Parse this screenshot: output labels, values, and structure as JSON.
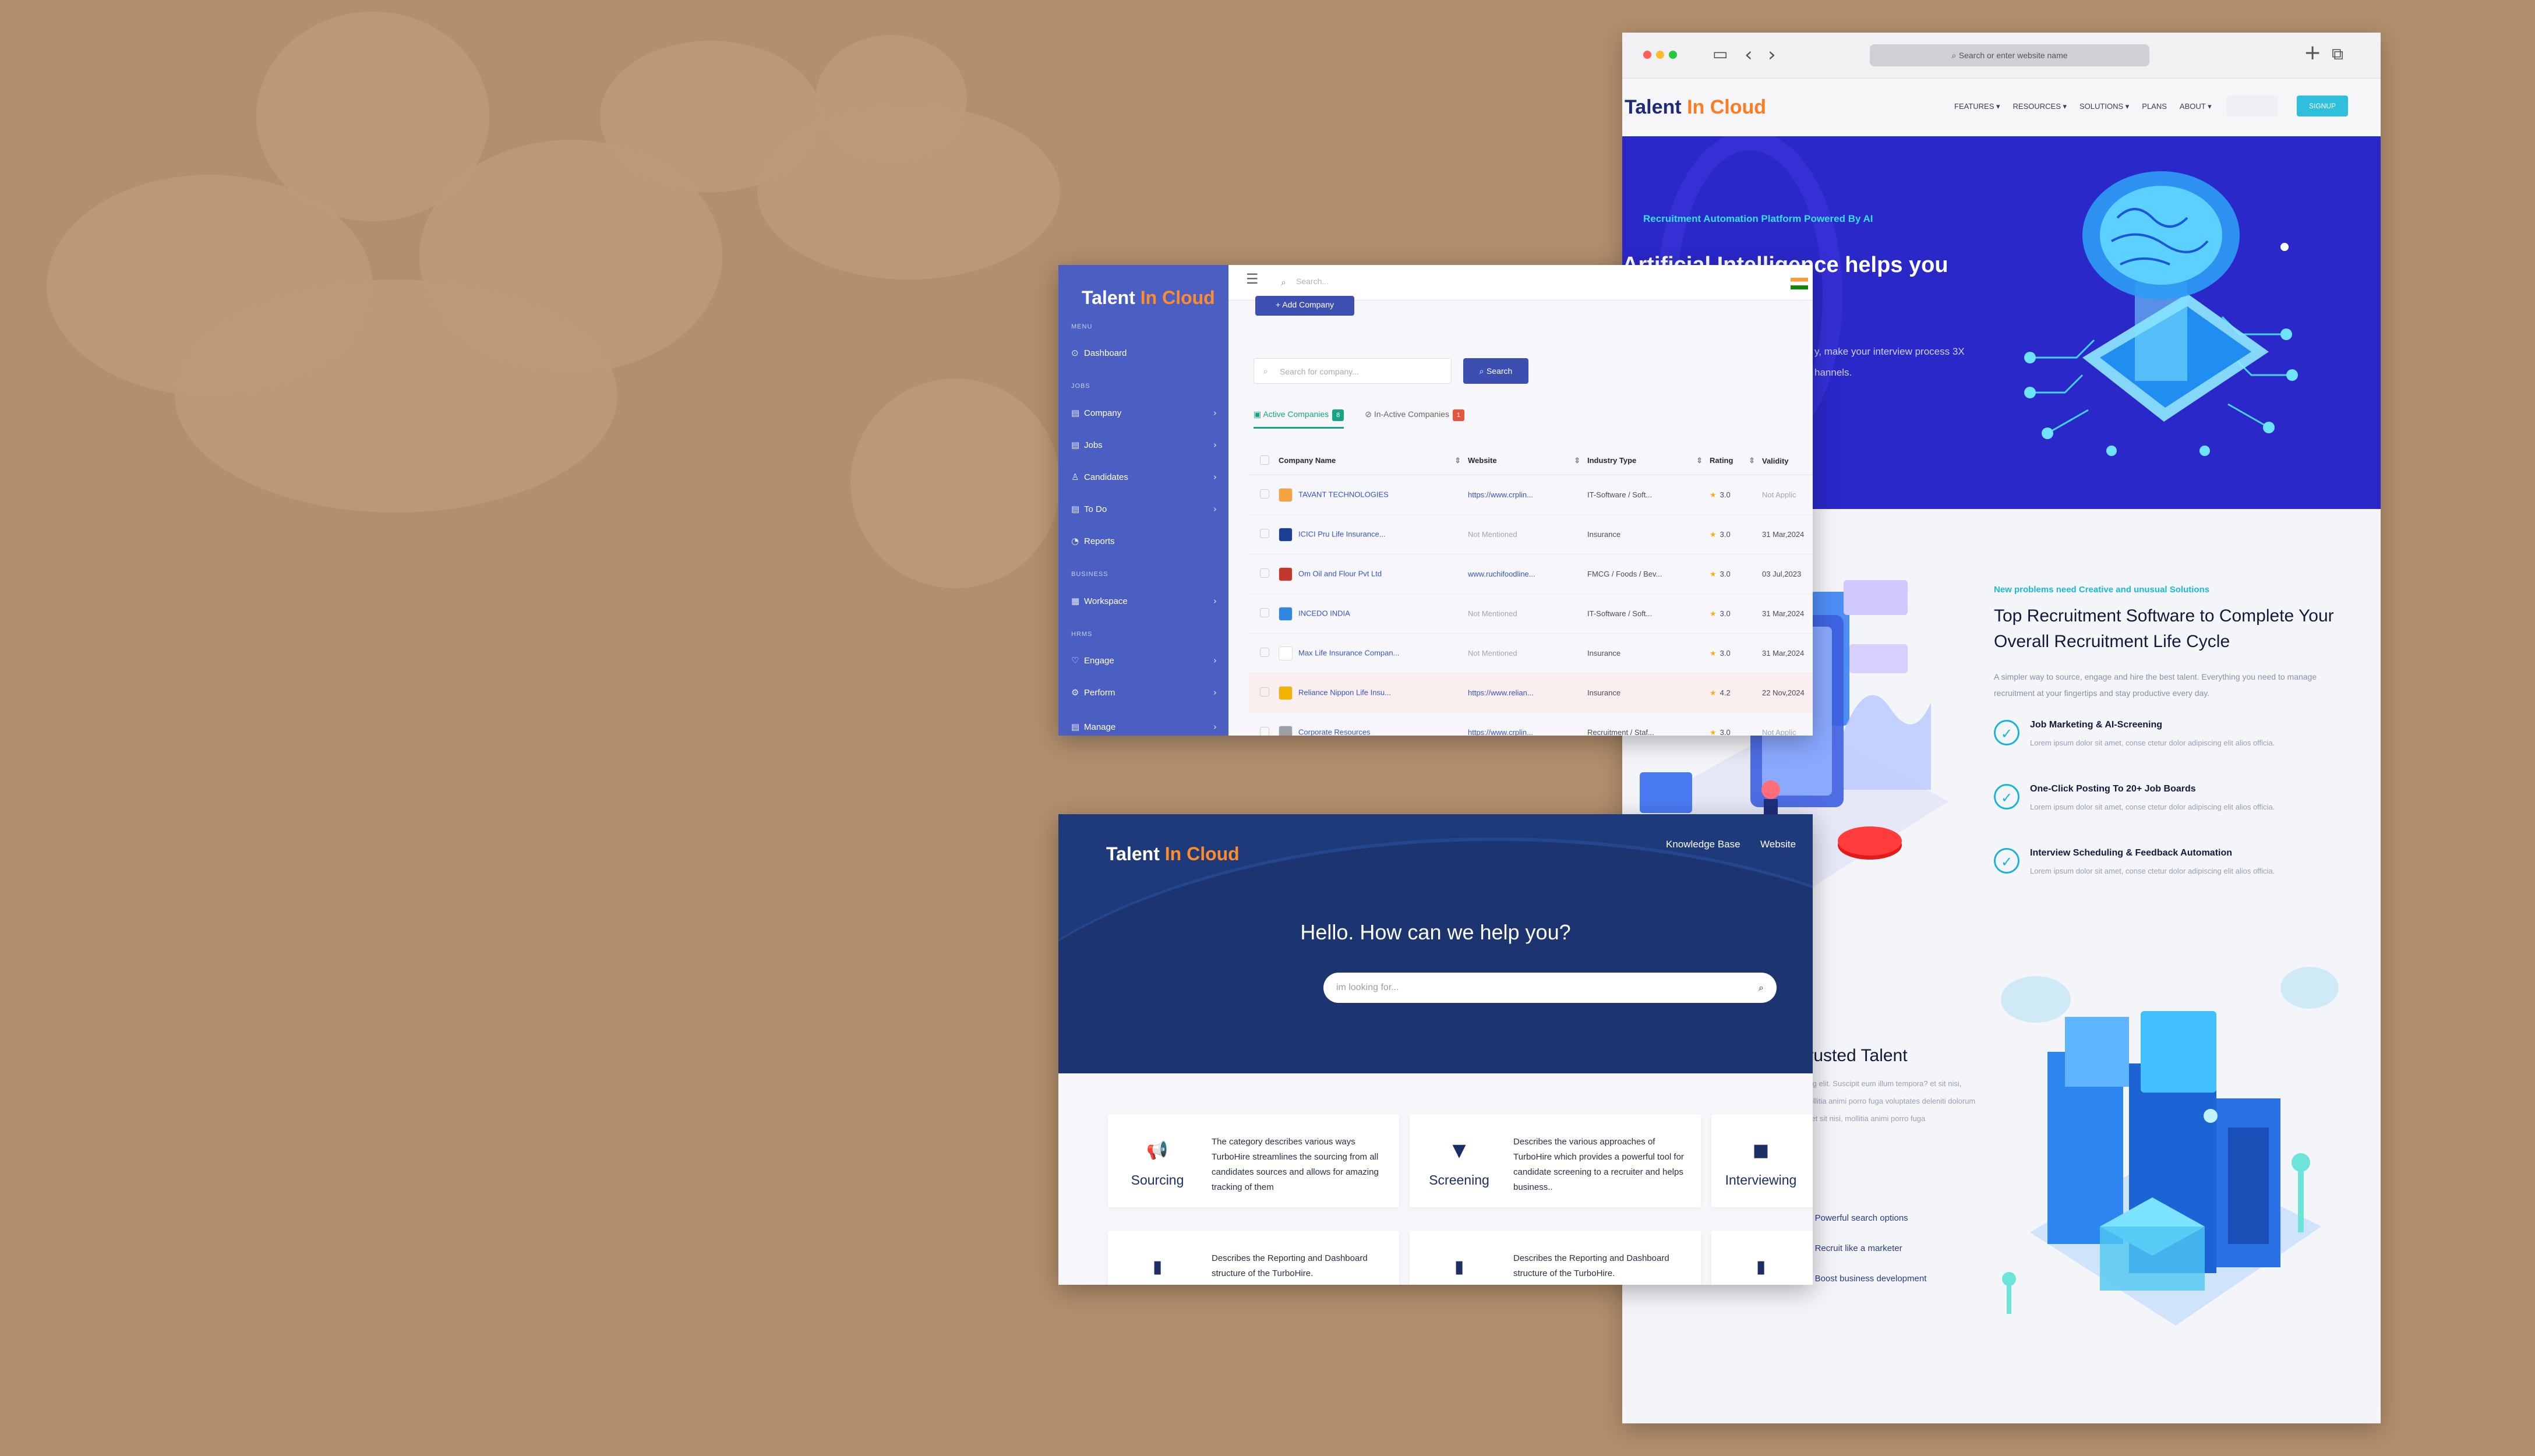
{
  "browser": {
    "address_placeholder": "Search or enter website name",
    "site": {
      "logo_text": "Talent",
      "logo_in": "In",
      "logo_cloud": "Cloud",
      "menu": [
        "FEATURES ▾",
        "RESOURCES ▾",
        "SOLUTIONS ▾",
        "PLANS",
        "ABOUT ▾"
      ],
      "signup_label": "SIGNUP",
      "hero_tag": "Recruitment Automation Platform Powered By AI",
      "hero_heading": "Artificial Intelligence helps you",
      "hero_sub_1": "y, make your interview process 3X",
      "hero_sub_2": "hannels.",
      "section_tag": "New problems need Creative and unusual Solutions",
      "section_heading": "Top Recruitment Software to Complete Your Overall Recruitment Life Cycle",
      "section_sub": "A simpler way to source, engage and hire the best talent. Everything you need to manage recruitment at your fingertips and stay productive every day.",
      "features": [
        {
          "title": "Job Marketing & AI-Screening",
          "desc": "Lorem ipsum dolor sit amet, conse ctetur dolor adipiscing elit alios officia."
        },
        {
          "title": "One-Click Posting To 20+ Job Boards",
          "desc": "Lorem ipsum dolor sit amet, conse ctetur dolor adipiscing elit alios officia."
        },
        {
          "title": "Interview Scheduling & Feedback Automation",
          "desc": "Lorem ipsum dolor sit amet, conse ctetur dolor adipiscing elit alios officia."
        }
      ],
      "trusted_heading": "trusted Talent",
      "trusted_sub": "cing elit. Suscipit eum illum tempora? et sit nisi, mollitia animi porro fuga voluptates deleniti dolorum et et sit nisi, mollitia animi porro fuga",
      "benefits": [
        "Powerful search options",
        "Recruit like a marketer",
        "Boost business development"
      ]
    }
  },
  "dashboard": {
    "logo_text": "Talent",
    "logo_in": "In",
    "logo_cloud": "Cloud",
    "search_placeholder": "Search...",
    "add_button": "+ Add Company",
    "company_search_placeholder": "Search for company...",
    "search_button": "Search",
    "sidebar": [
      {
        "type": "section",
        "label": "MENU"
      },
      {
        "type": "item",
        "icon": "⊙",
        "label": "Dashboard",
        "chevron": false
      },
      {
        "type": "section",
        "label": "JOBS"
      },
      {
        "type": "item",
        "icon": "▤",
        "label": "Company",
        "chevron": true
      },
      {
        "type": "item",
        "icon": "▤",
        "label": "Jobs",
        "chevron": true
      },
      {
        "type": "item",
        "icon": "♙",
        "label": "Candidates",
        "chevron": true
      },
      {
        "type": "item",
        "icon": "▤",
        "label": "To Do",
        "chevron": true
      },
      {
        "type": "item",
        "icon": "◔",
        "label": "Reports",
        "chevron": false
      },
      {
        "type": "section",
        "label": "BUSINESS"
      },
      {
        "type": "item",
        "icon": "▦",
        "label": "Workspace",
        "chevron": true
      },
      {
        "type": "section",
        "label": "HRMS"
      },
      {
        "type": "item",
        "icon": "♡",
        "label": "Engage",
        "chevron": true
      },
      {
        "type": "item",
        "icon": "⚙",
        "label": "Perform",
        "chevron": true
      },
      {
        "type": "item",
        "icon": "▤",
        "label": "Manage",
        "chevron": true
      }
    ],
    "tabs": {
      "active_label": "Active Companies",
      "active_count": "8",
      "inactive_label": "In-Active Companies",
      "inactive_count": "1"
    },
    "columns": [
      "Company Name",
      "Website",
      "Industry Type",
      "Rating",
      "Validity"
    ],
    "rows": [
      {
        "name": "TAVANT TECHNOLOGIES",
        "website": "https://www.crplin...",
        "industry": "IT-Software / Soft...",
        "rating": "3.0",
        "validity": "Not Applic",
        "logo_color": "#f4a340"
      },
      {
        "name": "ICICI Pru Life Insurance...",
        "website": "Not Mentioned",
        "industry": "Insurance",
        "rating": "3.0",
        "validity": "31 Mar,2024",
        "logo_color": "#1b3f95"
      },
      {
        "name": "Om Oil and Flour Pvt Ltd",
        "website": "www.ruchifoodline...",
        "industry": "FMCG / Foods / Bev...",
        "rating": "3.0",
        "validity": "03 Jul,2023",
        "logo_color": "#c0392b"
      },
      {
        "name": "INCEDO INDIA",
        "website": "Not Mentioned",
        "industry": "IT-Software / Soft...",
        "rating": "3.0",
        "validity": "31 Mar,2024",
        "logo_color": "#2e86de"
      },
      {
        "name": "Max Life Insurance Compan...",
        "website": "Not Mentioned",
        "industry": "Insurance",
        "rating": "3.0",
        "validity": "31 Mar,2024",
        "logo_color": "#ffffff"
      },
      {
        "name": "Reliance Nippon Life Insu...",
        "website": "https://www.relian...",
        "industry": "Insurance",
        "rating": "4.2",
        "validity": "22 Nov,2024",
        "logo_color": "#f0b400"
      },
      {
        "name": "Corporate Resources",
        "website": "https://www.crplin...",
        "industry": "Recruitment / Staf...",
        "rating": "3.0",
        "validity": "Not Applic",
        "logo_color": "#9aa0a6"
      }
    ]
  },
  "kb": {
    "logo_text": "Talent",
    "logo_in": "In",
    "logo_cloud": "Cloud",
    "link_kb": "Knowledge Base",
    "link_website": "Website",
    "title": "Hello. How can we help you?",
    "search_placeholder": "im looking for...",
    "cards": [
      {
        "name": "Sourcing",
        "icon": "megaphone-icon",
        "glyph": "📢",
        "desc": "The category describes various ways TurboHire streamlines the sourcing from all candidates sources and allows for amazing tracking of them"
      },
      {
        "name": "Screening",
        "icon": "funnel-icon",
        "glyph": "▼",
        "desc": "Describes the various approaches of TurboHire which provides a powerful tool for candidate screening to a recruiter and helps business.."
      },
      {
        "name": "Interviewing",
        "icon": "video-icon",
        "glyph": "■",
        "desc": ""
      },
      {
        "name": "",
        "icon": "bar-chart-icon",
        "glyph": "▮",
        "desc": "Describes the Reporting and Dashboard structure of the TurboHire."
      },
      {
        "name": "",
        "icon": "bar-chart-icon",
        "glyph": "▮",
        "desc": "Describes the Reporting and Dashboard structure of the TurboHire."
      },
      {
        "name": "",
        "icon": "bar-chart-icon",
        "glyph": "▮",
        "desc": ""
      }
    ]
  },
  "colors": {
    "background": "#b28f6d",
    "hero_blue": "#2a28c9",
    "sidebar": "#4a5fc1",
    "kb_navy": "#1e3a7a",
    "accent_orange": "#ff8c2a",
    "accent_cyan": "#1bb9d6"
  }
}
